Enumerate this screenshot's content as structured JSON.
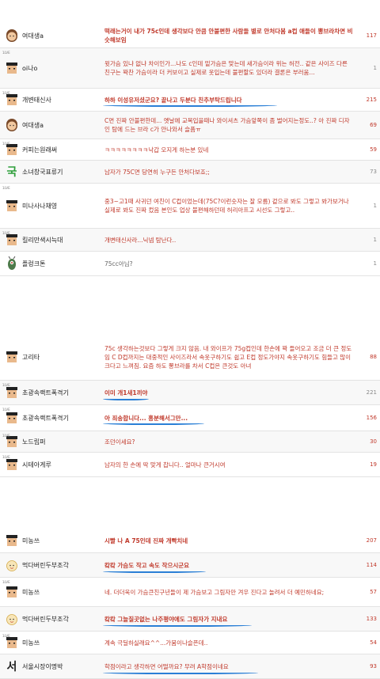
{
  "sections": [
    {
      "rows": [
        {
          "nick": "여대생a",
          "avatar": "girl-icon",
          "msg": "떡래는거이 내가 75c인데 생각보다 안큼 안불편한 사람들 별로 안처다봄 a컵 애들이 뽕브라차면 비슷해보임",
          "count": "117"
        },
        {
          "nick": "oi나o",
          "avatar": "student-icon",
          "msg": "윗가슴 있냐 없냐 차이인가...나도 c인데 밑가슴은 맞는데 새가슴이라 위는 허전.. 같은 사이즈 다른 친구는 꽉찬 가슴이라 더 커보이고 실제로 옷입는데 불편할도 있더라 결론은 부러움...",
          "count": "1"
        },
        {
          "nick": "개변태신사",
          "avatar": "student-icon",
          "msg": "하하 이성유저셨군요? 끝나고 두분다 친추부탁드립니다",
          "count": "215",
          "bold": true
        },
        {
          "nick": "여대생a",
          "avatar": "girl-icon",
          "msg": "C면 진짜 안불편한데... 옛날에 교복입을때나 와이셔츠 가슴앞쪽이 좀 벌어지는정도..? 아 진짜 디자인 탐에 드는 브라 c가 안나와서 슬픔ㅠ",
          "count": "69"
        },
        {
          "nick": "커피는원래써",
          "avatar": "student-icon",
          "msg": "ㅋㅋㅋㅋㅋㅋㅋㅋ낙갑 오지게 하는분 있네",
          "count": "59"
        },
        {
          "nick": "소녀창국표류기",
          "avatar": "guk-icon",
          "msg": "남자가 75C면 당연히 누구든 안처다보죠;;",
          "count": "73"
        },
        {
          "nick": "미나사나채영",
          "avatar": "student-icon",
          "msg": "중3~고1때 사귀던 여친이 C컵이었는데(75C?이런숫자는 잘 모름) 겉으로 봐도 그렇고 봐가보거나 실제로 봐도 진짜 컸음 본인도 업상 불편해하던데 허리아프고 시선도 그렇고..",
          "count": "1"
        },
        {
          "nick": "킬리만색시늑대",
          "avatar": "student-icon",
          "msg": "개변태신사라...닉넴 탐난다..",
          "count": "1"
        },
        {
          "nick": "플렁크톤",
          "avatar": "plankton-icon",
          "msg": "75cc아님?",
          "count": "1"
        }
      ]
    },
    {
      "rows": [
        {
          "nick": "고리타",
          "avatar": "student-icon",
          "msg": "75c 생각하는것보다 그렇게 크지 않음. 내 와이프가 75g컵인데 한손에 꽉 들어오고 조금 더 큰 정도임 C D컵까지는 대중적인 사이즈라서 속옷구하기도 쉽고 E컵 정도가야지 속옷구하기도 힘들고 많이 크다고 느껴짐. 요즘 하도 뽕브라를 차서 C컵은 큰것도 아녀",
          "count": "88"
        },
        {
          "nick": "초광속랙트폭격기",
          "avatar": "student-icon",
          "msg": "이미 개1새1끼야",
          "count": "221",
          "bold": true
        },
        {
          "nick": "초광속랙트폭격기",
          "avatar": "student-icon",
          "msg": "아 죄송합니다... 흥분해서그만...",
          "count": "156",
          "bold": true
        },
        {
          "nick": "노드립퍼",
          "avatar": "student-icon",
          "msg": "조던이세요?",
          "count": "30"
        },
        {
          "nick": "시테아게루",
          "avatar": "student-icon",
          "msg": "남자의 한 손에 딱 맞게 찹니다.. 얼마나 큰거시여",
          "count": "19"
        }
      ]
    },
    {
      "rows": [
        {
          "nick": "미농쓰",
          "avatar": "student-icon",
          "msg": "시빨 나 A 75인데 진짜 개빡치네",
          "count": "207",
          "bold": true
        },
        {
          "nick": "먹다버린두부조각",
          "avatar": "baby-icon",
          "msg": "캌캌 가슴도 작고 속도 작으시군요",
          "count": "114",
          "bold": true
        },
        {
          "nick": "미농쓰",
          "avatar": "student-icon",
          "msg": "네. 더더욱이 가슴큰친구년들이 제 가슴보고 그림자만 겨우 진다고 놀려서 더 예민하네요;",
          "count": "57"
        },
        {
          "nick": "먹다버린두부조각",
          "avatar": "baby-icon",
          "msg": "캌캌 그늘질곳없는 나주평야에도 그림자가 지내요",
          "count": "133",
          "bold": true
        },
        {
          "nick": "미농쓰",
          "avatar": "student-icon",
          "msg": "계속 극딜하실래요^^...가뭄이나슬픈데..",
          "count": "54"
        },
        {
          "nick": "서울시장이명박",
          "avatar": "seo-icon",
          "msg": "학점이라고 생각하면 어떨까요? 무려 A학점이네요",
          "count": "93"
        }
      ]
    }
  ]
}
